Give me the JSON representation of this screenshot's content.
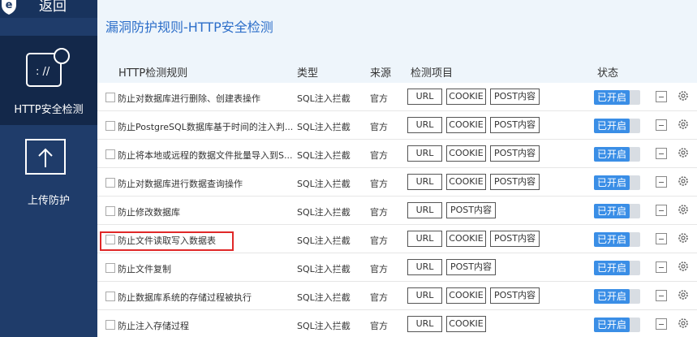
{
  "sidebar": {
    "back_label": "返回",
    "items": [
      {
        "label": "HTTP安全检测",
        "icon": "web-shield-icon",
        "active": true
      },
      {
        "label": "上传防护",
        "icon": "upload-icon",
        "active": false
      }
    ]
  },
  "page": {
    "title": "漏洞防护规则-HTTP安全检测"
  },
  "table": {
    "headers": {
      "rule": "HTTP检测规则",
      "type": "类型",
      "source": "来源",
      "items": "检测项目",
      "status": "状态"
    },
    "rows": [
      {
        "name": "防止对数据库进行删除、创建表操作",
        "type": "SQL注入拦截",
        "source": "官方",
        "tags": [
          "URL",
          "COOKIE",
          "POST内容"
        ],
        "status": "已开启"
      },
      {
        "name": "防止PostgreSQL数据库基于时间的注入判...",
        "type": "SQL注入拦截",
        "source": "官方",
        "tags": [
          "URL",
          "COOKIE",
          "POST内容"
        ],
        "status": "已开启"
      },
      {
        "name": "防止将本地或远程的数据文件批量导入到S...",
        "type": "SQL注入拦截",
        "source": "官方",
        "tags": [
          "URL",
          "COOKIE",
          "POST内容"
        ],
        "status": "已开启"
      },
      {
        "name": "防止对数据库进行数据查询操作",
        "type": "SQL注入拦截",
        "source": "官方",
        "tags": [
          "URL",
          "COOKIE",
          "POST内容"
        ],
        "status": "已开启"
      },
      {
        "name": "防止修改数据库",
        "type": "SQL注入拦截",
        "source": "官方",
        "tags": [
          "URL",
          "POST内容"
        ],
        "status": "已开启"
      },
      {
        "name": "防止文件读取写入数据表",
        "type": "SQL注入拦截",
        "source": "官方",
        "tags": [
          "URL",
          "COOKIE",
          "POST内容"
        ],
        "status": "已开启"
      },
      {
        "name": "防止文件复制",
        "type": "SQL注入拦截",
        "source": "官方",
        "tags": [
          "URL",
          "POST内容"
        ],
        "status": "已开启"
      },
      {
        "name": "防止数据库系统的存储过程被执行",
        "type": "SQL注入拦截",
        "source": "官方",
        "tags": [
          "URL",
          "COOKIE",
          "POST内容"
        ],
        "status": "已开启"
      },
      {
        "name": "防止注入存储过程",
        "type": "SQL注入拦截",
        "source": "官方",
        "tags": [
          "URL",
          "COOKIE"
        ],
        "status": "已开启"
      }
    ]
  },
  "colors": {
    "sidebar_bg": "#1f3c6a",
    "sidebar_active": "#13284a",
    "accent": "#3a8ee6",
    "title_text": "#2c6ec9",
    "highlight_box": "#e02828"
  }
}
